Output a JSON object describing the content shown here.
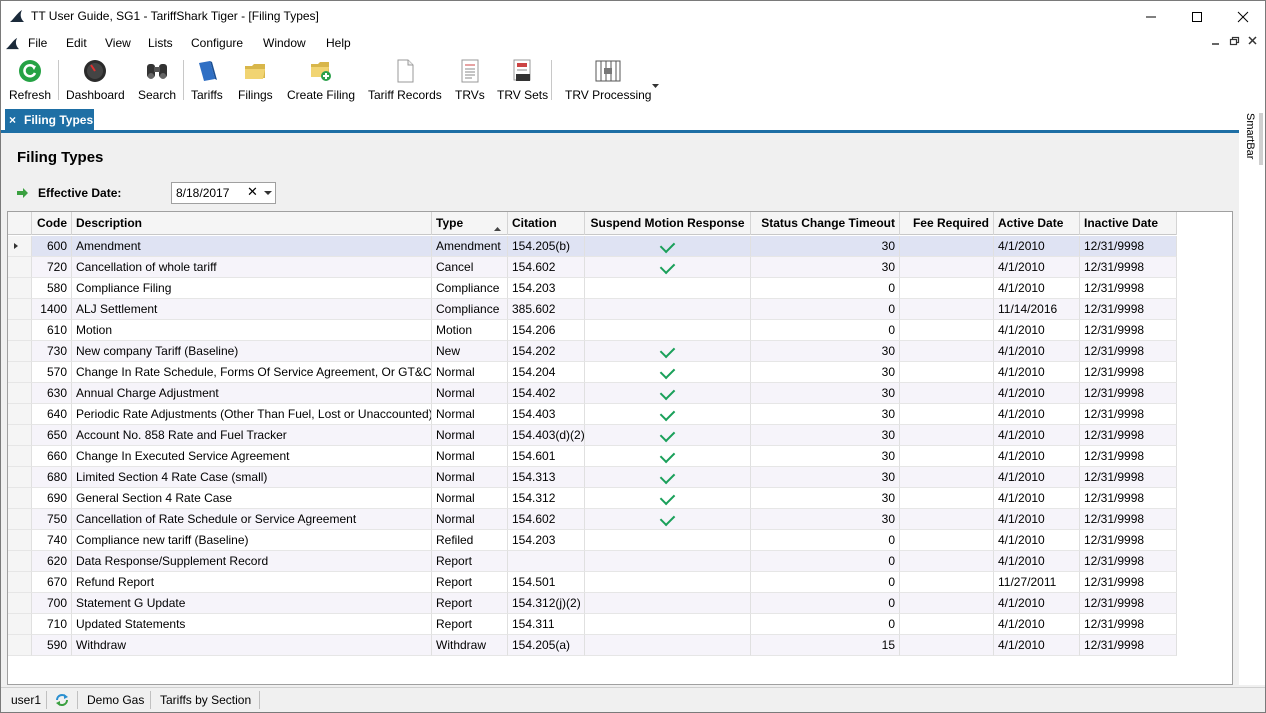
{
  "window": {
    "title": "TT User Guide, SG1 - TariffShark Tiger - [Filing Types]"
  },
  "menu": [
    "File",
    "Edit",
    "View",
    "Lists",
    "Configure",
    "Window",
    "Help"
  ],
  "toolbar": {
    "refresh": "Refresh",
    "dashboard": "Dashboard",
    "search": "Search",
    "tariffs": "Tariffs",
    "filings": "Filings",
    "create_filing": "Create Filing",
    "tariff_records": "Tariff Records",
    "trvs": "TRVs",
    "trv_sets": "TRV Sets",
    "trv_processing": "TRV Processing"
  },
  "tab": {
    "close": "×",
    "label": "Filing Types"
  },
  "smartbar": {
    "label": "SmartBar"
  },
  "page": {
    "title": "Filing Types",
    "effective_date_label": "Effective Date:",
    "effective_date_value": "8/18/2017"
  },
  "grid": {
    "columns": [
      "Code",
      "Description",
      "Type",
      "Citation",
      "Suspend Motion Response",
      "Status Change Timeout",
      "Fee Required",
      "Active Date",
      "Inactive Date"
    ],
    "sort_column": "Type",
    "rows": [
      {
        "code": "600",
        "description": "Amendment",
        "type": "Amendment",
        "citation": "154.205(b)",
        "suspend": true,
        "timeout": "30",
        "fee": "",
        "active": "4/1/2010",
        "inactive": "12/31/9998"
      },
      {
        "code": "720",
        "description": "Cancellation of whole tariff",
        "type": "Cancel",
        "citation": "154.602",
        "suspend": true,
        "timeout": "30",
        "fee": "",
        "active": "4/1/2010",
        "inactive": "12/31/9998"
      },
      {
        "code": "580",
        "description": "Compliance Filing",
        "type": "Compliance",
        "citation": "154.203",
        "suspend": false,
        "timeout": "0",
        "fee": "",
        "active": "4/1/2010",
        "inactive": "12/31/9998"
      },
      {
        "code": "1400",
        "description": "ALJ Settlement",
        "type": "Compliance",
        "citation": "385.602",
        "suspend": false,
        "timeout": "0",
        "fee": "",
        "active": "11/14/2016",
        "inactive": "12/31/9998"
      },
      {
        "code": "610",
        "description": "Motion",
        "type": "Motion",
        "citation": "154.206",
        "suspend": false,
        "timeout": "0",
        "fee": "",
        "active": "4/1/2010",
        "inactive": "12/31/9998"
      },
      {
        "code": "730",
        "description": "New company Tariff (Baseline)",
        "type": "New",
        "citation": "154.202",
        "suspend": true,
        "timeout": "30",
        "fee": "",
        "active": "4/1/2010",
        "inactive": "12/31/9998"
      },
      {
        "code": "570",
        "description": "Change In Rate Schedule, Forms Of Service Agreement, Or  GT&C",
        "type": "Normal",
        "citation": "154.204",
        "suspend": true,
        "timeout": "30",
        "fee": "",
        "active": "4/1/2010",
        "inactive": "12/31/9998"
      },
      {
        "code": "630",
        "description": "Annual Charge Adjustment",
        "type": "Normal",
        "citation": "154.402",
        "suspend": true,
        "timeout": "30",
        "fee": "",
        "active": "4/1/2010",
        "inactive": "12/31/9998"
      },
      {
        "code": "640",
        "description": "Periodic Rate Adjustments (Other Than Fuel, Lost or Unaccounted)",
        "type": "Normal",
        "citation": "154.403",
        "suspend": true,
        "timeout": "30",
        "fee": "",
        "active": "4/1/2010",
        "inactive": "12/31/9998"
      },
      {
        "code": "650",
        "description": "Account No. 858 Rate and Fuel Tracker",
        "type": "Normal",
        "citation": "154.403(d)(2)",
        "suspend": true,
        "timeout": "30",
        "fee": "",
        "active": "4/1/2010",
        "inactive": "12/31/9998"
      },
      {
        "code": "660",
        "description": "Change In Executed Service Agreement",
        "type": "Normal",
        "citation": "154.601",
        "suspend": true,
        "timeout": "30",
        "fee": "",
        "active": "4/1/2010",
        "inactive": "12/31/9998"
      },
      {
        "code": "680",
        "description": "Limited Section 4 Rate Case (small)",
        "type": "Normal",
        "citation": "154.313",
        "suspend": true,
        "timeout": "30",
        "fee": "",
        "active": "4/1/2010",
        "inactive": "12/31/9998"
      },
      {
        "code": "690",
        "description": "General Section 4 Rate Case",
        "type": "Normal",
        "citation": "154.312",
        "suspend": true,
        "timeout": "30",
        "fee": "",
        "active": "4/1/2010",
        "inactive": "12/31/9998"
      },
      {
        "code": "750",
        "description": "Cancellation of Rate Schedule or Service Agreement",
        "type": "Normal",
        "citation": "154.602",
        "suspend": true,
        "timeout": "30",
        "fee": "",
        "active": "4/1/2010",
        "inactive": "12/31/9998"
      },
      {
        "code": "740",
        "description": "Compliance new tariff (Baseline)",
        "type": "Refiled",
        "citation": "154.203",
        "suspend": false,
        "timeout": "0",
        "fee": "",
        "active": "4/1/2010",
        "inactive": "12/31/9998"
      },
      {
        "code": "620",
        "description": "Data Response/Supplement Record",
        "type": "Report",
        "citation": "",
        "suspend": false,
        "timeout": "0",
        "fee": "",
        "active": "4/1/2010",
        "inactive": "12/31/9998"
      },
      {
        "code": "670",
        "description": "Refund Report",
        "type": "Report",
        "citation": "154.501",
        "suspend": false,
        "timeout": "0",
        "fee": "",
        "active": "11/27/2011",
        "inactive": "12/31/9998"
      },
      {
        "code": "700",
        "description": "Statement G Update",
        "type": "Report",
        "citation": "154.312(j)(2)",
        "suspend": false,
        "timeout": "0",
        "fee": "",
        "active": "4/1/2010",
        "inactive": "12/31/9998"
      },
      {
        "code": "710",
        "description": "Updated Statements",
        "type": "Report",
        "citation": "154.311",
        "suspend": false,
        "timeout": "0",
        "fee": "",
        "active": "4/1/2010",
        "inactive": "12/31/9998"
      },
      {
        "code": "590",
        "description": "Withdraw",
        "type": "Withdraw",
        "citation": "154.205(a)",
        "suspend": false,
        "timeout": "15",
        "fee": "",
        "active": "4/1/2010",
        "inactive": "12/31/9998"
      }
    ]
  },
  "statusbar": {
    "user": "user1",
    "company": "Demo Gas",
    "mode": "Tariffs by Section"
  },
  "colors": {
    "accent": "#1e6fa5",
    "check": "#1aa05a",
    "selected_row": "#dfe3f3",
    "alt_row": "#f6f4fa"
  }
}
